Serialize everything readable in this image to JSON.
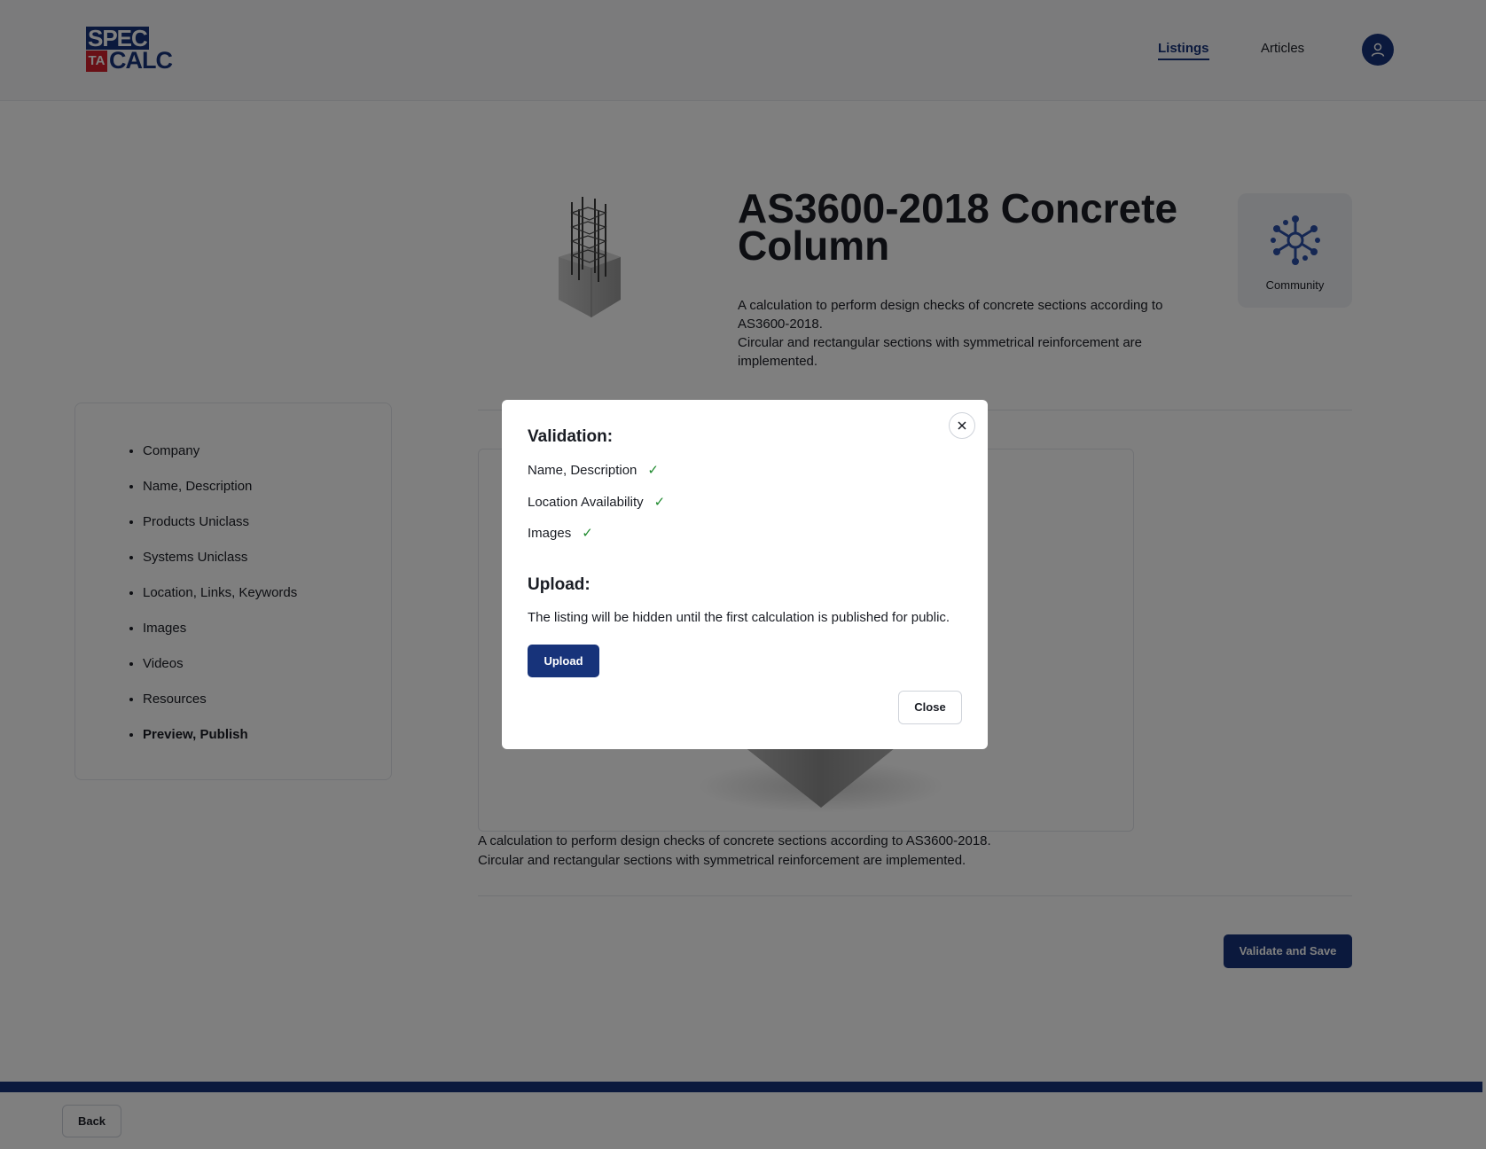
{
  "header": {
    "logo": {
      "line1": "SPEC",
      "badge": "TA",
      "line2": "CALC"
    },
    "nav": [
      {
        "label": "Listings",
        "active": true
      },
      {
        "label": "Articles",
        "active": false
      }
    ],
    "avatar_icon": "user-icon"
  },
  "listing": {
    "title": "AS3600-2018 Concrete Column",
    "description_line1": "A calculation to perform design checks of concrete sections according to AS3600-2018.",
    "description_line2": "Circular and rectangular sections with symmetrical reinforcement are implemented.",
    "badge_label": "Community",
    "badge_icon": "community-network-icon"
  },
  "sidebar": {
    "items": [
      {
        "label": "Company"
      },
      {
        "label": "Name, Description"
      },
      {
        "label": "Products Uniclass"
      },
      {
        "label": "Systems Uniclass"
      },
      {
        "label": "Location, Links, Keywords"
      },
      {
        "label": "Images"
      },
      {
        "label": "Videos"
      },
      {
        "label": "Resources"
      },
      {
        "label": "Preview, Publish",
        "current": true
      }
    ]
  },
  "preview": {
    "description_line1": "A calculation to perform design checks of concrete sections according to AS3600-2018.",
    "description_line2": "Circular and rectangular sections with symmetrical reinforcement are implemented."
  },
  "actions": {
    "validate_save_label": "Validate and Save",
    "back_label": "Back"
  },
  "modal": {
    "validation_heading": "Validation:",
    "checks": [
      {
        "label": "Name, Description",
        "status": "✓"
      },
      {
        "label": "Location Availability",
        "status": "✓"
      },
      {
        "label": "Images",
        "status": "✓"
      }
    ],
    "upload_heading": "Upload:",
    "upload_note": "The listing will be hidden until the first calculation is published for public.",
    "upload_label": "Upload",
    "close_label": "Close"
  },
  "colors": {
    "brand": "#17337a",
    "accent_red": "#d3212d",
    "check_green": "#1f8a2e"
  }
}
